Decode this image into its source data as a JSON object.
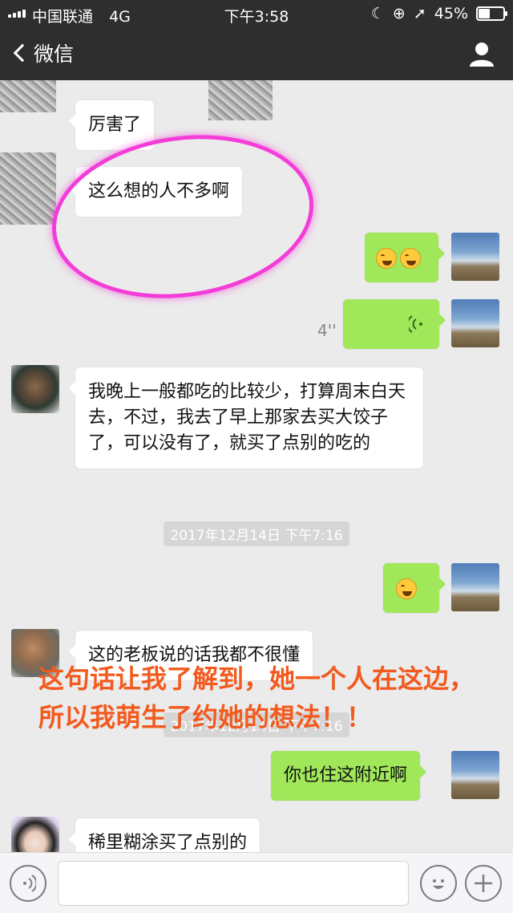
{
  "status_bar": {
    "carrier": "中国联通",
    "network": "4G",
    "time": "下午3:58",
    "battery": "45%",
    "battery_level": 0.45
  },
  "nav": {
    "back_label": "微信"
  },
  "messages": [
    {
      "side": "in",
      "type": "text",
      "text": "厉害了"
    },
    {
      "side": "in",
      "type": "text",
      "text": "这么想的人不多啊"
    },
    {
      "side": "out",
      "type": "emoji",
      "emoji": "crying-laughing-icon",
      "count": 2
    },
    {
      "side": "out",
      "type": "voice",
      "duration": "4''"
    },
    {
      "side": "in",
      "type": "text",
      "text": "我晚上一般都吃的比较少，打算周末白天去，不过，我去了早上那家去买大饺子了，可以没有了，就买了点别的吃的"
    },
    {
      "type": "timestamp",
      "text": "2017年12月14日 下午7:16"
    },
    {
      "side": "out",
      "type": "emoji",
      "emoji": "crying-laughing-icon",
      "count": 1
    },
    {
      "side": "in",
      "type": "text",
      "text": "这的老板说的话我都不很懂"
    },
    {
      "type": "timestamp",
      "text": "2017年12月14日 下午7:16"
    },
    {
      "side": "out",
      "type": "text",
      "text": "你也住这附近啊"
    },
    {
      "side": "in",
      "type": "text",
      "text": "稀里糊涂买了点别的"
    }
  ],
  "annotation": {
    "text": "这句话让我了解到，她一个人在这边，所以我萌生了约她的想法！！",
    "color": "#f25a1e",
    "circle_color": "#f33cd8"
  },
  "colors": {
    "bar": "#2e2e2e",
    "chat_bg": "#ebebeb",
    "out_bubble": "#a0e75a",
    "in_bubble": "#ffffff"
  }
}
